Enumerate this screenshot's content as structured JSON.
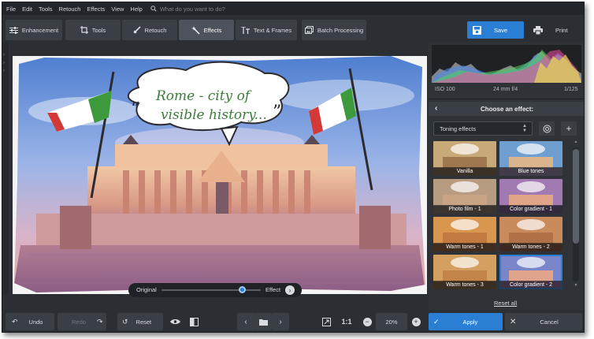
{
  "menubar": {
    "items": [
      "File",
      "Edit",
      "Tools",
      "Retouch",
      "Effects",
      "View",
      "Help"
    ],
    "search_placeholder": "What do you want to do?"
  },
  "toolbar": {
    "tabs": [
      {
        "label": "Enhancement",
        "icon": "sliders-icon"
      },
      {
        "label": "Tools",
        "icon": "crop-icon"
      },
      {
        "label": "Retouch",
        "icon": "brush-icon"
      },
      {
        "label": "Effects",
        "icon": "magic-wand-icon",
        "active": true
      },
      {
        "label": "Text & Frames",
        "icon": "text-icon"
      },
      {
        "label": "Batch Processing",
        "icon": "batch-icon"
      }
    ],
    "save_label": "Save",
    "print_label": "Print"
  },
  "photo": {
    "caption": "Rome - city of visible history...",
    "caption_line1": "Rome - city of",
    "caption_line2": "visible history..."
  },
  "compare": {
    "original_label": "Original",
    "effect_label": "Effect",
    "position": 0.78
  },
  "histogram": {
    "iso": "ISO 100",
    "lens": "24 mm f/4",
    "shutter": "1/125"
  },
  "effects": {
    "header": "Choose an effect:",
    "category": "Toning effects",
    "items": [
      {
        "label": "Vanilla",
        "tint": "#c8a978"
      },
      {
        "label": "Blue tones",
        "tint": "#6f9ed0"
      },
      {
        "label": "Photo film - 1",
        "tint": "#b79c82"
      },
      {
        "label": "Color gradient - 1",
        "tint": "#a07ab0"
      },
      {
        "label": "Warm tones - 1",
        "tint": "#d9964f"
      },
      {
        "label": "Warm tones - 2",
        "tint": "#c98a5c"
      },
      {
        "label": "Warm tones - 3",
        "tint": "#d4a060"
      },
      {
        "label": "Color gradient - 2",
        "tint": "#7a86c9",
        "selected": true
      }
    ],
    "reset_all": "Reset all"
  },
  "bottombar": {
    "undo_label": "Undo",
    "redo_label": "Redo",
    "reset_label": "Reset",
    "zoom_ratio": "1:1",
    "zoom_level": "20%",
    "apply_label": "Apply",
    "cancel_label": "Cancel"
  },
  "colors": {
    "accent": "#2a7fd4",
    "background": "#2b2e33"
  }
}
